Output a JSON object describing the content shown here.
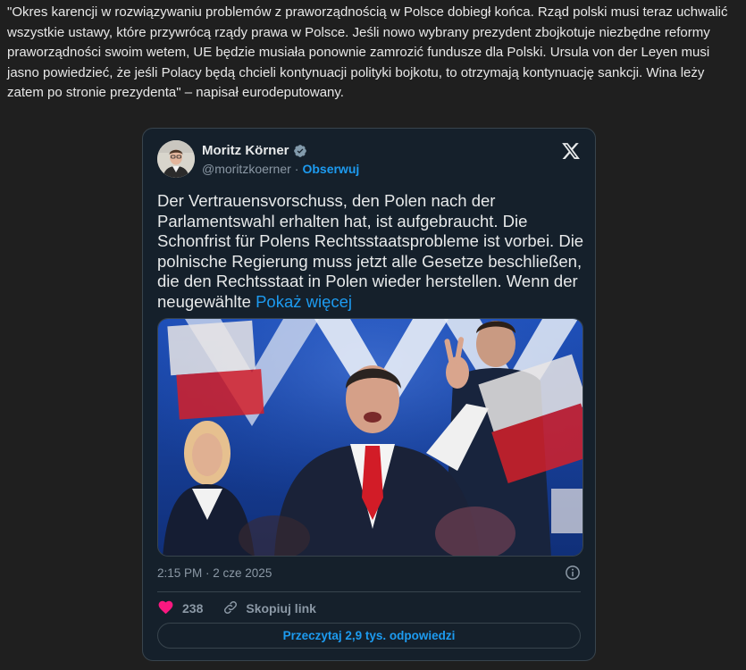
{
  "article": {
    "quote": "\"Okres karencji w rozwiązywaniu problemów z praworządnością w Polsce dobiegł końca. Rząd polski musi teraz uchwalić wszystkie ustawy, które przywrócą rządy prawa w Polsce. Jeśli nowo wybrany prezydent zbojkotuje niezbędne reformy praworządności swoim wetem, UE będzie musiała ponownie zamrozić fundusze dla Polski. Ursula von der Leyen musi jasno powiedzieć, że jeśli Polacy będą chcieli kontynuacji polityki bojkotu, to otrzymają kontynuację sankcji. Wina leży zatem po stronie prezydenta\" – napisał eurodeputowany."
  },
  "tweet": {
    "author_name": "Moritz Körner",
    "handle": "@moritzkoerner",
    "separator": "·",
    "follow_label": "Obserwuj",
    "text": "Der Vertrauensvorschuss, den Polen nach der Parlamentswahl erhalten hat, ist aufgebraucht. Die Schonfrist für Polens Rechtsstaatsprobleme ist vorbei. Die polnische Regierung muss jetzt alle Gesetze beschließen, die den Rechtsstaat in Polen wieder herstellen. Wenn der neugewählte",
    "show_more_label": "Pokaż więcej",
    "timestamp": "2:15 PM · 2 cze 2025",
    "like_count": "238",
    "copy_link_label": "Skopiuj link",
    "replies_label": "Przeczytaj 2,9 tys. odpowiedzi"
  },
  "colors": {
    "page_bg": "#1f1f1f",
    "card_bg": "#15202b",
    "accent": "#1d9bf0",
    "like": "#f91880",
    "muted": "#8b98a5"
  },
  "icons": {
    "verified": "verified-badge-icon",
    "logo": "x-logo-icon",
    "info": "info-icon",
    "like": "heart-icon",
    "link": "link-icon"
  }
}
